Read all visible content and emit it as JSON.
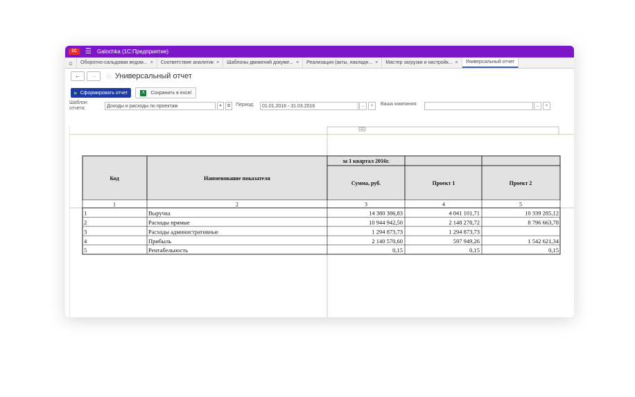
{
  "app": {
    "logo": "1С",
    "title": "Galochka  (1С:Предприятие)"
  },
  "tabs": [
    {
      "label": "Оборотно-сальдовая ведом..."
    },
    {
      "label": "Соответствие аналитик"
    },
    {
      "label": "Шаблоны движений докуме..."
    },
    {
      "label": "Реализация (акты, накладн..."
    },
    {
      "label": "Мастер загрузки и настройк..."
    },
    {
      "label": "Универсальный отчет"
    }
  ],
  "page": {
    "title": "Универсальный отчет",
    "back_icon": "←",
    "forward_icon": "→",
    "star_icon": "☆"
  },
  "toolbar": {
    "generate_label": "Сформировать отчет",
    "excel_label": "Сохранить в excel"
  },
  "params": {
    "template_label_1": "Шаблон",
    "template_label_2": "отчета:",
    "template_value": "Доходы и расходы по проектам",
    "period_label": "Период:",
    "period_value": "01.01.2016 - 31.03.2016",
    "company_label": "Ваша компания:",
    "company_value": "",
    "ellipsis": "...",
    "clear": "×",
    "dropdown": "▾",
    "open": "⧉"
  },
  "report": {
    "period_header": "за 1 квартал 2016г.",
    "columns": [
      "Код",
      "Наименование показателя",
      "Сумма, руб.",
      "Проект 1",
      "Проект 2"
    ],
    "column_numbers": [
      "1",
      "2",
      "3",
      "4",
      "5"
    ],
    "rows": [
      {
        "code": "1",
        "name": "Выручка",
        "sum": "14 380 386,83",
        "p1": "4 041 101,71",
        "p2": "10 339 285,12"
      },
      {
        "code": "2",
        "name": "Расходы прямые",
        "sum": "10 944 942,50",
        "p1": "2 148 278,72",
        "p2": "8 796 663,78"
      },
      {
        "code": "3",
        "name": "Расходы административные",
        "sum": "1 294 873,73",
        "p1": "1 294 873,73",
        "p2": ""
      },
      {
        "code": "4",
        "name": "Прибыль",
        "sum": "2 140 570,60",
        "p1": "597 949,26",
        "p2": "1 542 621,34"
      },
      {
        "code": "5",
        "name": "Рентабельность",
        "sum": "0,15",
        "p1": "0,15",
        "p2": "0,15"
      }
    ]
  }
}
